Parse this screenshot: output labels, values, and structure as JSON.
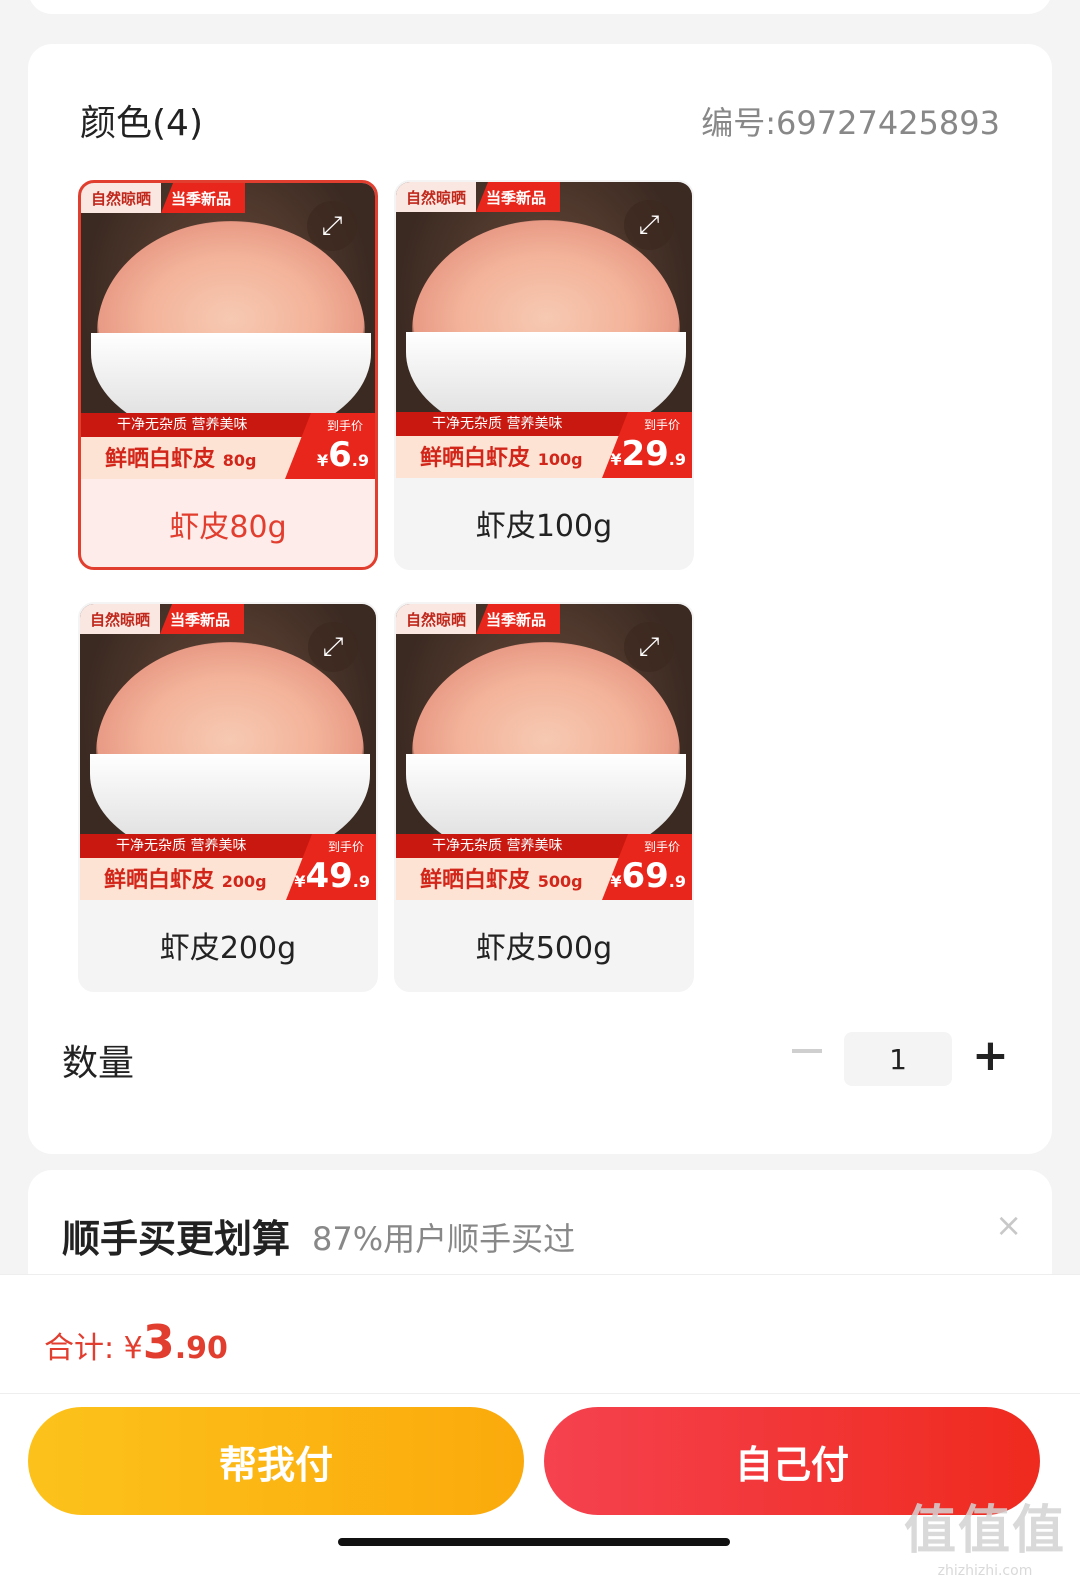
{
  "spec": {
    "title": "颜色(4)",
    "code": "编号:69727425893",
    "options": [
      {
        "label": "虾皮80g",
        "tag_a": "自然晾晒",
        "tag_b": "当季新品",
        "promo_line": "干净无杂质 营养美味",
        "promo_name": "鲜晒白虾皮",
        "promo_weight": "80g",
        "price_label": "到手价",
        "price_currency": "¥",
        "price_int": "6",
        "price_dec": ".9",
        "selected": true
      },
      {
        "label": "虾皮100g",
        "tag_a": "自然晾晒",
        "tag_b": "当季新品",
        "promo_line": "干净无杂质 营养美味",
        "promo_name": "鲜晒白虾皮",
        "promo_weight": "100g",
        "price_label": "到手价",
        "price_currency": "¥",
        "price_int": "29",
        "price_dec": ".9",
        "selected": false
      },
      {
        "label": "虾皮200g",
        "tag_a": "自然晾晒",
        "tag_b": "当季新品",
        "promo_line": "干净无杂质 营养美味",
        "promo_name": "鲜晒白虾皮",
        "promo_weight": "200g",
        "price_label": "到手价",
        "price_currency": "¥",
        "price_int": "49",
        "price_dec": ".9",
        "selected": false
      },
      {
        "label": "虾皮500g",
        "tag_a": "自然晾晒",
        "tag_b": "当季新品",
        "promo_line": "干净无杂质 营养美味",
        "promo_name": "鲜晒白虾皮",
        "promo_weight": "500g",
        "price_label": "到手价",
        "price_currency": "¥",
        "price_int": "69",
        "price_dec": ".9",
        "selected": false
      }
    ]
  },
  "quantity": {
    "label": "数量",
    "value": "1",
    "minus": "−",
    "plus": "+"
  },
  "upsell": {
    "title": "顺手买更划算",
    "subtitle": "87%用户顺手买过",
    "close": "×"
  },
  "footer": {
    "total_label": "合计: ¥",
    "total_int": "3",
    "total_dec": ".90",
    "help_pay": "帮我付",
    "self_pay": "自己付"
  },
  "watermark": {
    "main": "值值值",
    "sub": "zhizhizhi.com"
  },
  "colors": {
    "accent": "#e23e2f",
    "help_button": "#fbaa0c",
    "self_button": "#ef2a1e"
  }
}
